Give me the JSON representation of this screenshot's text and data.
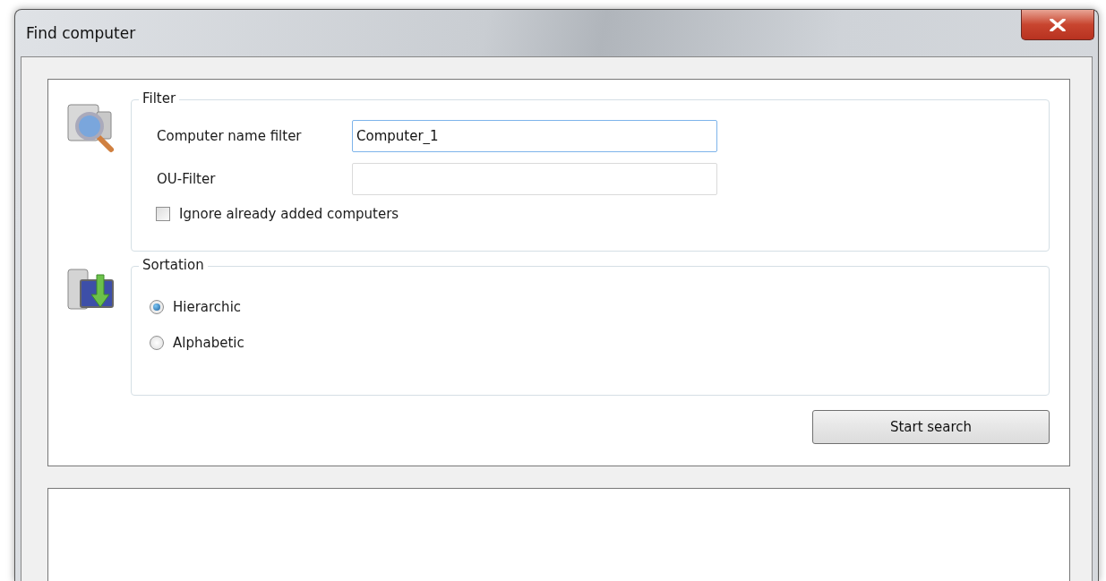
{
  "window": {
    "title": "Find computer"
  },
  "filter": {
    "legend": "Filter",
    "fields": [
      {
        "label": "Computer name filter",
        "value": "Computer_1",
        "focused": true
      },
      {
        "label": "OU-Filter",
        "focused": false
      }
    ],
    "checkbox": {
      "label": "Ignore already added computers",
      "checked": false
    }
  },
  "sortation": {
    "legend": "Sortation",
    "options": [
      {
        "label": "Hierarchic",
        "selected": true
      },
      {
        "label": "Alphabetic",
        "selected": false
      }
    ]
  },
  "buttons": [
    "Start search"
  ]
}
